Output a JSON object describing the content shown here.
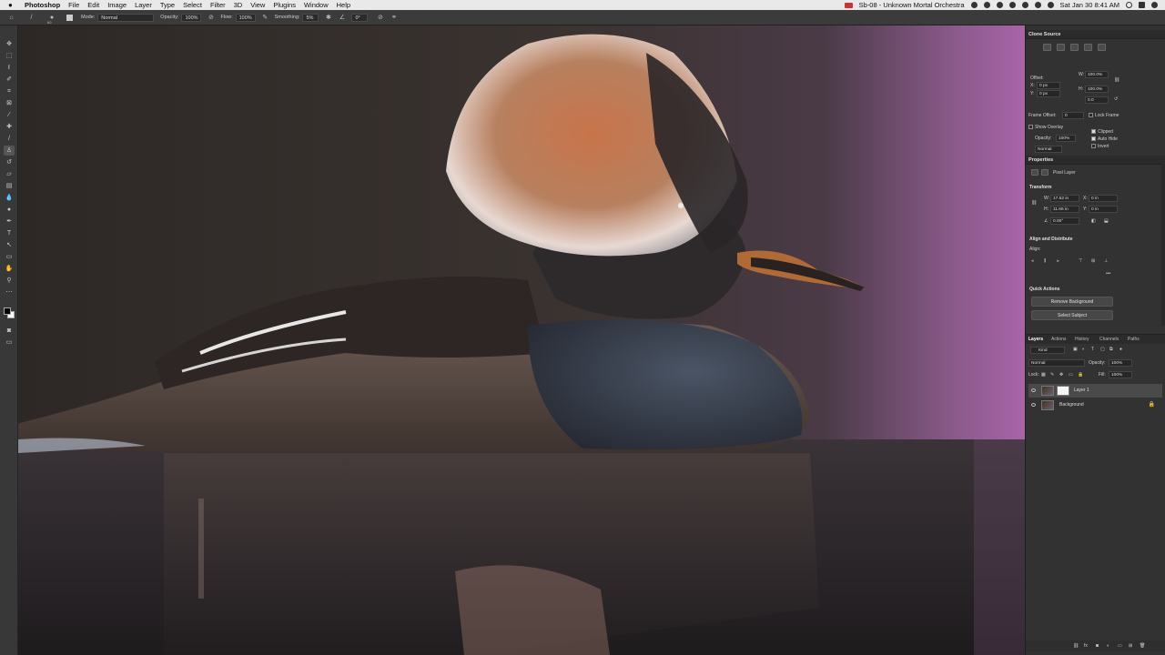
{
  "menubar": {
    "app_name": "Photoshop",
    "items": [
      "File",
      "Edit",
      "Image",
      "Layer",
      "Type",
      "Select",
      "Filter",
      "3D",
      "View",
      "Plugins",
      "Window",
      "Help"
    ],
    "now_playing": "Sb-08 - Unknown Mortal Orchestra",
    "clock": "Sat Jan 30  8:41 AM"
  },
  "options_bar": {
    "brush_size": "60",
    "mode_label": "Mode:",
    "mode_value": "Normal",
    "opacity_label": "Opacity:",
    "opacity_value": "100%",
    "flow_label": "Flow:",
    "flow_value": "100%",
    "smoothing_label": "Smoothing:",
    "smoothing_value": "5%",
    "angle_value": "0°"
  },
  "clone_source": {
    "title": "Clone Source",
    "offset_label": "Offset:",
    "x_label": "X:",
    "x_value": "0 px",
    "y_label": "Y:",
    "y_value": "0 px",
    "w_label": "W:",
    "w_value": "100.0%",
    "h_label": "H:",
    "h_value": "100.0%",
    "rotation_value": "0.0",
    "frame_offset_label": "Frame Offset:",
    "frame_offset_value": "0",
    "lock_frame_label": "Lock Frame",
    "show_overlay_label": "Show Overlay",
    "opacity_label": "Opacity:",
    "opacity_value": "100%",
    "blend_mode_value": "Normal",
    "clipped_label": "Clipped",
    "auto_hide_label": "Auto Hide",
    "invert_label": "Invert"
  },
  "properties": {
    "title": "Properties",
    "layer_type": "Pixel Layer",
    "transform_title": "Transform",
    "w_label": "W:",
    "w_value": "17.52 in",
    "h_label": "H:",
    "h_value": "11.66 in",
    "x_label": "X:",
    "x_value": "0 in",
    "y_label": "Y:",
    "y_value": "0 in",
    "angle_value": "0.00°",
    "align_title": "Align and Distribute",
    "align_label": "Align:",
    "quick_actions_title": "Quick Actions",
    "remove_background_label": "Remove Background",
    "select_subject_label": "Select Subject"
  },
  "layers_panel": {
    "tabs": [
      "Layers",
      "Actions",
      "History",
      "Channels",
      "Paths"
    ],
    "filter_value": "Kind",
    "blend_mode_value": "Normal",
    "opacity_label": "Opacity:",
    "opacity_value": "100%",
    "lock_label": "Lock:",
    "fill_label": "Fill:",
    "fill_value": "100%",
    "layers": [
      {
        "name": "Layer 1",
        "selected": true
      },
      {
        "name": "Background",
        "locked": true
      }
    ]
  },
  "colors": {
    "menubar_bg": "#e9e9e9",
    "panel_bg": "#323232",
    "selected_layer": "#4a4a4a"
  }
}
